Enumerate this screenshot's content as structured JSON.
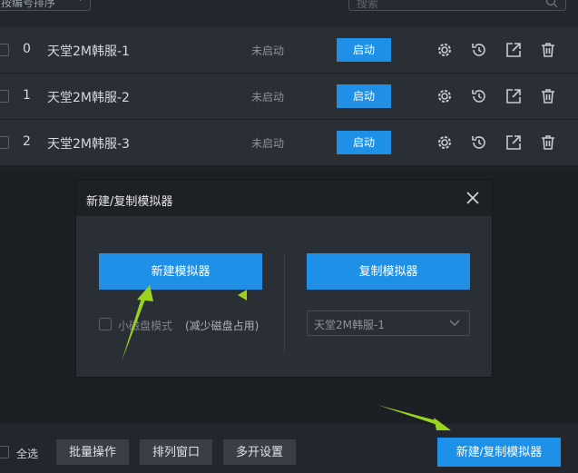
{
  "topbar": {
    "sort_label": "按编号排序",
    "search_placeholder": "搜索"
  },
  "rows": [
    {
      "index": "0",
      "name": "天堂2M韩服-1",
      "status": "未启动",
      "start_label": "启动"
    },
    {
      "index": "1",
      "name": "天堂2M韩服-2",
      "status": "未启动",
      "start_label": "启动"
    },
    {
      "index": "2",
      "name": "天堂2M韩服-3",
      "status": "未启动",
      "start_label": "启动"
    }
  ],
  "row_icons": [
    "gear-icon",
    "history-icon",
    "export-icon",
    "trash-icon"
  ],
  "modal": {
    "title": "新建/复制模拟器",
    "new_button": "新建模拟器",
    "copy_button": "复制模拟器",
    "small_disk_label": "小磁盘模式",
    "small_disk_hint": "(减少磁盘占用)",
    "copy_source_value": "天堂2M韩服-1"
  },
  "bottombar": {
    "select_all_label": "全选",
    "batch_label": "批量操作",
    "arrange_label": "排列窗口",
    "multi_label": "多开设置",
    "new_copy_label": "新建/复制模拟器"
  },
  "colors": {
    "accent": "#1e90e8",
    "annotation_arrow": "#9ad41e",
    "background": "#1f2228"
  }
}
